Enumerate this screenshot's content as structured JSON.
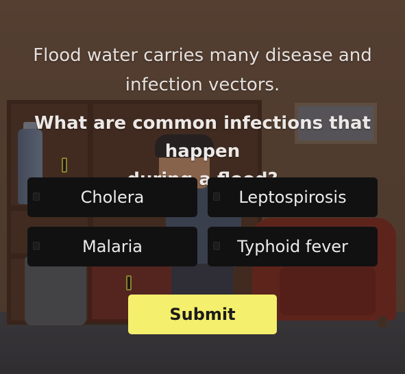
{
  "prompt": {
    "line1": "Flood water carries many disease and",
    "line2": "infection vectors."
  },
  "question": {
    "line1": "What are common infections that happen",
    "line2": "during a flood?"
  },
  "options": [
    {
      "label": "Cholera",
      "checked": false
    },
    {
      "label": "Leptospirosis",
      "checked": false
    },
    {
      "label": "Malaria",
      "checked": false
    },
    {
      "label": "Typhoid fever",
      "checked": false
    }
  ],
  "submit_label": "Submit",
  "colors": {
    "option_bg": "#111111",
    "submit_bg": "#f4ef6c",
    "text": "#ecebea"
  }
}
